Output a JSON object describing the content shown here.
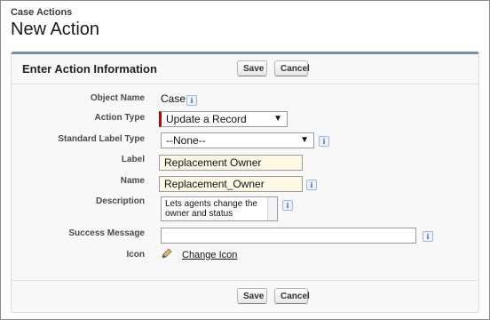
{
  "header": {
    "breadcrumb": "Case Actions",
    "title": "New Action"
  },
  "panel": {
    "title": "Enter Action Information",
    "save_label": "Save",
    "cancel_label": "Cancel"
  },
  "form": {
    "object_name": {
      "label": "Object Name",
      "value": "Case"
    },
    "action_type": {
      "label": "Action Type",
      "value": "Update a Record"
    },
    "standard_label_type": {
      "label": "Standard Label Type",
      "value": "--None--"
    },
    "label": {
      "label": "Label",
      "value": "Replacement Owner"
    },
    "name": {
      "label": "Name",
      "value": "Replacement_Owner"
    },
    "description": {
      "label": "Description",
      "value": "Lets agents change the owner and status"
    },
    "success_message": {
      "label": "Success Message",
      "value": ""
    },
    "icon": {
      "label": "Icon",
      "link": "Change Icon"
    }
  },
  "icons": {
    "info": "i",
    "dropdown": "▼",
    "icon_preview": "pencil-icon"
  },
  "colors": {
    "required_marker": "#c00000",
    "panel_accent": "#7a8ea3",
    "field_highlight": "#fff8e4"
  }
}
